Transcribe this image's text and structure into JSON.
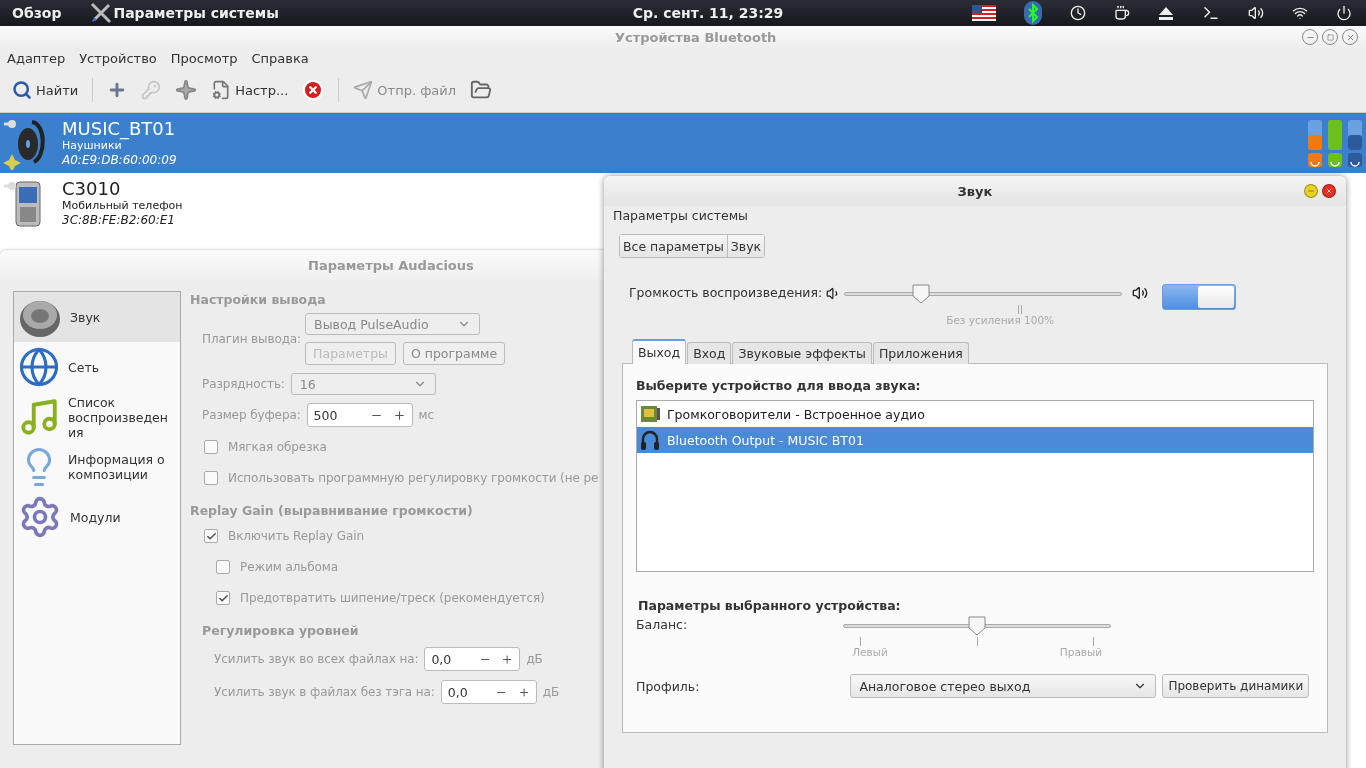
{
  "top_bar": {
    "activities": "Обзор",
    "app_name": "Параметры системы",
    "clock": "Ср. сент. 11, 23:29"
  },
  "bluetooth": {
    "title": "Устройства Bluetooth",
    "menu": [
      "Адаптер",
      "Устройство",
      "Просмотр",
      "Справка"
    ],
    "toolbar": [
      {
        "kind": "button",
        "label": "Найти",
        "disabled": false
      },
      {
        "kind": "separator"
      },
      {
        "kind": "icon",
        "disabled": false
      },
      {
        "kind": "icon",
        "disabled": true
      },
      {
        "kind": "icon",
        "disabled": false
      },
      {
        "kind": "button",
        "label": "Настр...",
        "disabled": false
      },
      {
        "kind": "icon",
        "disabled": false
      },
      {
        "kind": "separator"
      },
      {
        "kind": "button",
        "label": "Отпр. файл",
        "disabled": true
      },
      {
        "kind": "icon",
        "disabled": false
      }
    ],
    "devices": [
      {
        "name": "MUSIC_BT01",
        "type": "Наушники",
        "address": "A0:E9:DB:60:00:09",
        "selected": true,
        "meters": [
          {
            "level": 0.5,
            "color": "#f07a10"
          },
          {
            "level": 1,
            "color": "#6cc01c"
          },
          {
            "level": 0.5,
            "color": "#2c5a9c"
          }
        ]
      },
      {
        "name": "C3010",
        "type": "Мобильный телефон",
        "address": "3C:8B:FE:B2:60:E1",
        "selected": false
      }
    ]
  },
  "audacious": {
    "title": "Параметры Audacious",
    "sidebar": [
      {
        "label": "Звук",
        "selected": true
      },
      {
        "label": "Сеть",
        "selected": false
      },
      {
        "label": "Список воспроизведения",
        "selected": false
      },
      {
        "label": "Информация о композиции",
        "selected": false
      },
      {
        "label": "Модули",
        "selected": false
      }
    ],
    "output_heading": "Настройки вывода",
    "plugin_label": "Плагин вывода:",
    "plugin_value": "Вывод PulseAudio",
    "plugin_buttons": [
      {
        "label": "Параметры",
        "disabled": true
      },
      {
        "label": "О программе",
        "disabled": false
      }
    ],
    "bit_depth_label": "Разрядность:",
    "bit_depth_value": "16",
    "buffer_label": "Размер буфера:",
    "buffer_value": "500",
    "buffer_unit": "мс",
    "output_options": [
      {
        "label": "Мягкая обрезка",
        "checked": false
      },
      {
        "label": "Использовать программную регулировку громкости (не ре",
        "checked": false
      }
    ],
    "replay_heading": "Replay Gain (выравнивание громкости)",
    "replay_options": [
      {
        "label": "Включить Replay Gain",
        "checked": true
      },
      {
        "label": "Режим альбома",
        "checked": false
      },
      {
        "label": "Предотвратить шипение/треск (рекомендуется)",
        "checked": true
      }
    ],
    "levels_heading": "Регулировка уровней",
    "gains": [
      {
        "label": "Усилить звук во всех файлах на:",
        "value": "0,0",
        "unit": "дБ"
      },
      {
        "label": "Усилить звук в файлах без тэга на:",
        "value": "0,0",
        "unit": "дБ"
      }
    ]
  },
  "sound": {
    "title": "Звук",
    "header": "Параметры системы",
    "breadcrumbs": [
      "Все параметры",
      "Звук"
    ],
    "volume": {
      "label": "Громкость воспроизведения:",
      "level": 0.26,
      "on": true,
      "mark_label": "Без усиления 100%"
    },
    "tabs": [
      {
        "label": "Выход",
        "selected": true
      },
      {
        "label": "Вход",
        "selected": false
      },
      {
        "label": "Звуковые эффекты",
        "selected": false
      },
      {
        "label": "Приложения",
        "selected": false
      }
    ],
    "device_heading": "Выберите устройство для ввода звука:",
    "devices": [
      {
        "name": "Громкоговорители - Встроенное аудио",
        "selected": false
      },
      {
        "name": "Bluetooth Output - MUSIC BT01",
        "selected": true
      }
    ],
    "settings_heading": "Параметры выбранного устройства:",
    "balance": {
      "label": "Баланс:",
      "level": 0.5,
      "left_label": "Левый",
      "right_label": "Правый"
    },
    "profile": {
      "label": "Профиль:",
      "value": "Аналоговое стерео выход",
      "test_button": "Проверить динамики"
    }
  }
}
